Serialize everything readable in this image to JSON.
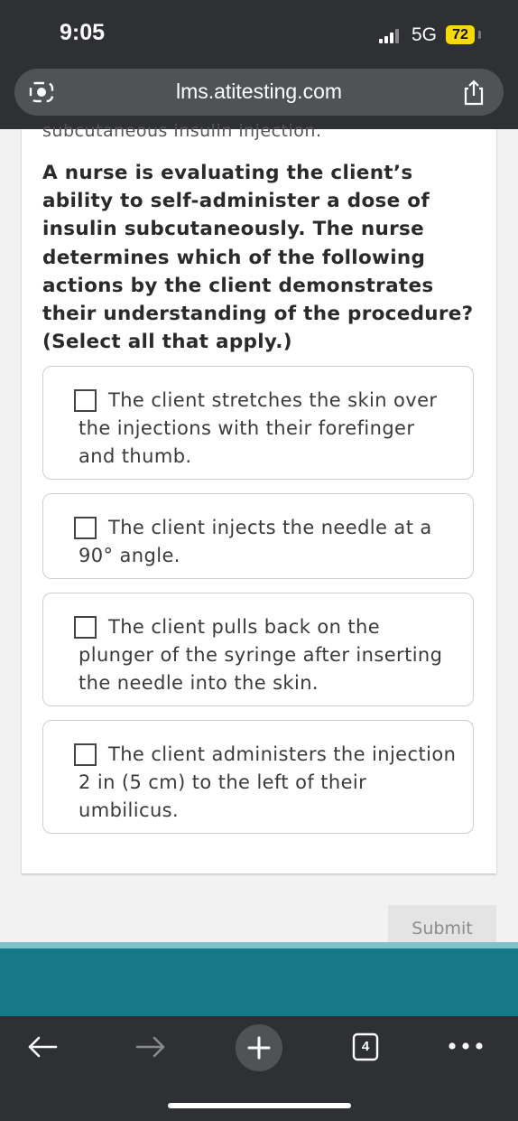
{
  "status": {
    "time": "9:05",
    "network": "5G",
    "battery": "72"
  },
  "browser": {
    "url": "lms.atitesting.com",
    "tabs_count": "4"
  },
  "content": {
    "cutoff_text": "subcutaneous insulin injection.",
    "question": "A nurse is evaluating the client’s ability to self-administer a dose of insulin subcutaneously. The nurse determines which of the following actions by the client demonstrates their understanding of the procedure? (Select all that apply.)",
    "options": [
      {
        "label": "The client stretches the skin over the injections with their forefinger and thumb.",
        "checked": false
      },
      {
        "label": "The client injects the needle at a 90° angle.",
        "checked": false
      },
      {
        "label": "The client pulls back on the plunger of the syringe after inserting the needle into the skin.",
        "checked": false
      },
      {
        "label": "The client administers the injection 2 in (5 cm) to the left of their umbilicus.",
        "checked": false
      }
    ],
    "submit_label": "Submit"
  },
  "colors": {
    "teal": "#15798a",
    "teal_light": "#7ec2cc",
    "browser_chrome": "#2e3033"
  }
}
